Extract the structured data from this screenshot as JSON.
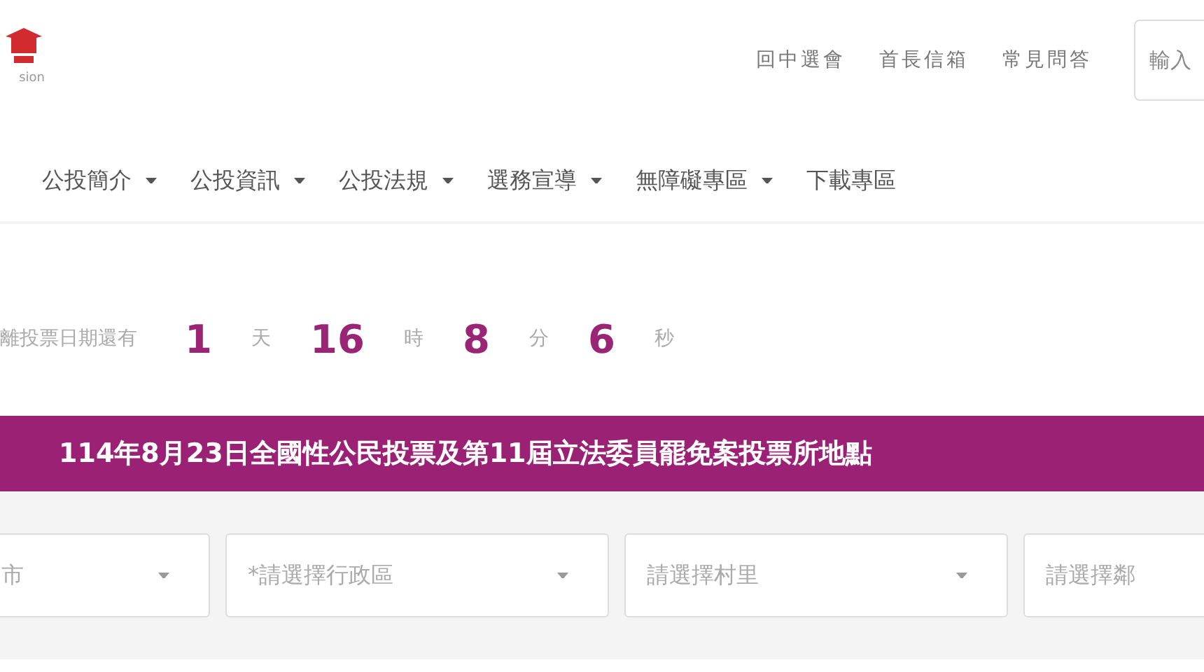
{
  "logo": {
    "caption": "sion"
  },
  "top_links": [
    "回中選會",
    "首長信箱",
    "常見問答"
  ],
  "search": {
    "placeholder": "輸入"
  },
  "nav": [
    {
      "label": "公投簡介",
      "dropdown": true
    },
    {
      "label": "公投資訊",
      "dropdown": true
    },
    {
      "label": "公投法規",
      "dropdown": true
    },
    {
      "label": "選務宣導",
      "dropdown": true
    },
    {
      "label": "無障礙專區",
      "dropdown": true
    },
    {
      "label": "下載專區",
      "dropdown": false
    }
  ],
  "countdown": {
    "label": "離投票日期還有",
    "units": [
      {
        "value": "1",
        "unit": "天"
      },
      {
        "value": "16",
        "unit": "時"
      },
      {
        "value": "8",
        "unit": "分"
      },
      {
        "value": "6",
        "unit": "秒"
      }
    ]
  },
  "banner": "114年8月23日全國性公民投票及第11屆立法委員罷免案投票所地點",
  "selects": [
    {
      "placeholder": "市",
      "caret": true
    },
    {
      "placeholder": "*請選擇行政區",
      "caret": true
    },
    {
      "placeholder": "請選擇村里",
      "caret": true
    },
    {
      "placeholder": "請選擇鄰",
      "caret": false
    }
  ]
}
